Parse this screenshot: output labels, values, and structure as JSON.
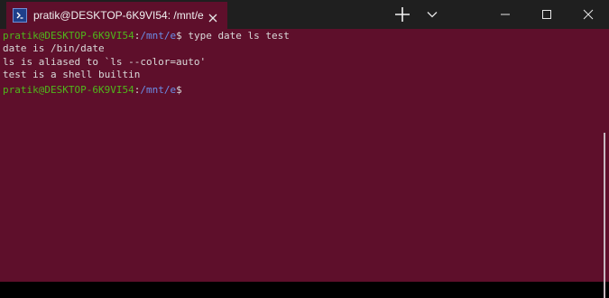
{
  "window": {
    "tab_title": "pratik@DESKTOP-6K9VI54: /mnt/e",
    "tab_icon": "powershell-prompt-icon",
    "colors": {
      "terminal_bg": "#5e0f2b",
      "titlebar_bg": "#1f1f1f",
      "user_host": "#4fb71b",
      "path": "#6b8ee8",
      "text": "#d9d9d9"
    }
  },
  "terminal": {
    "prompt1": {
      "user_host": "pratik@DESKTOP-6K9VI54",
      "sep": ":",
      "path": "/mnt/e",
      "dollar": "$",
      "command": " type date ls test"
    },
    "output": [
      "date is /bin/date",
      "ls is aliased to `ls --color=auto'",
      "test is a shell builtin"
    ],
    "prompt2": {
      "user_host": "pratik@DESKTOP-6K9VI54",
      "sep": ":",
      "path": "/mnt/e",
      "dollar": "$"
    }
  }
}
